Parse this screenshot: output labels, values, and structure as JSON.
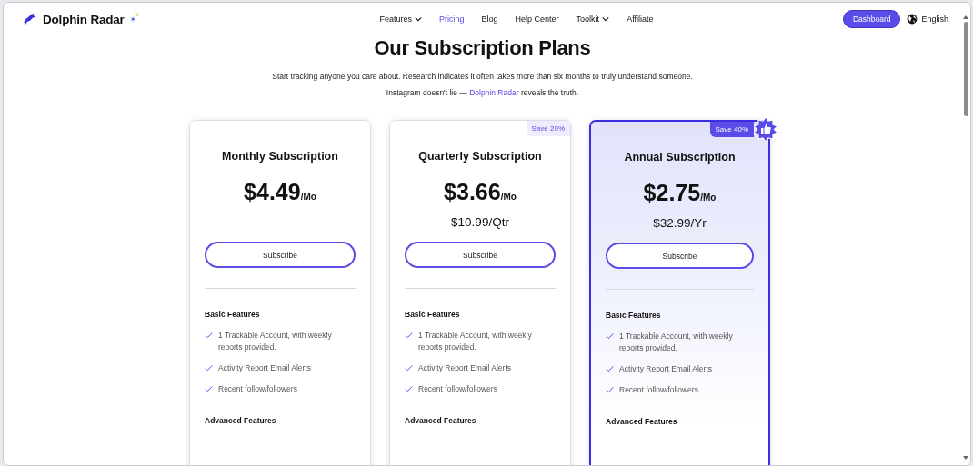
{
  "header": {
    "brand": "Dolphin Radar",
    "nav": [
      {
        "label": "Features",
        "dropdown": true,
        "selected": false
      },
      {
        "label": "Pricing",
        "dropdown": false,
        "selected": true
      },
      {
        "label": "Blog",
        "dropdown": false,
        "selected": false
      },
      {
        "label": "Help Center",
        "dropdown": false,
        "selected": false
      },
      {
        "label": "Toolkit",
        "dropdown": true,
        "selected": false
      },
      {
        "label": "Affiliate",
        "dropdown": false,
        "selected": false
      }
    ],
    "dashboard_button": "Dashboard",
    "language": "English"
  },
  "hero": {
    "title": "Our Subscription Plans",
    "subtitle": "Start tracking anyone you care about. Research indicates it often takes more than six months to truly understand someone.",
    "tagline": {
      "before": "Instagram doesn't lie —",
      "link": "Dolphin Radar",
      "after": "reveals the truth."
    }
  },
  "plans": [
    {
      "name": "Monthly Subscription",
      "price": "$4.49",
      "unit": "/Mo",
      "highlighted": false,
      "button": "Subscribe",
      "sections": [
        {
          "title": "Basic Features",
          "features": [
            "1 Trackable Account, with weekly reports provided.",
            "Activity Report Email Alerts",
            "Recent follow/followers"
          ]
        },
        {
          "title": "Advanced Features"
        }
      ]
    },
    {
      "name": "Quarterly Subscription",
      "price": "$3.66",
      "unit": "/Mo",
      "total": "$10.99/Qtr",
      "badge": "Save 20%",
      "highlighted": false,
      "button": "Subscribe",
      "sections": [
        {
          "title": "Basic Features",
          "features": [
            "1 Trackable Account, with weekly reports provided.",
            "Activity Report Email Alerts",
            "Recent follow/followers"
          ]
        },
        {
          "title": "Advanced Features"
        }
      ]
    },
    {
      "name": "Annual Subscription",
      "price": "$2.75",
      "unit": "/Mo",
      "total": "$32.99/Yr",
      "badge": "Save 40%",
      "highlighted": true,
      "button": "Subscribe",
      "sections": [
        {
          "title": "Basic Features",
          "features": [
            "1 Trackable Account, with weekly reports provided.",
            "Activity Report Email Alerts",
            "Recent follow/followers"
          ]
        },
        {
          "title": "Advanced Features"
        }
      ]
    }
  ]
}
